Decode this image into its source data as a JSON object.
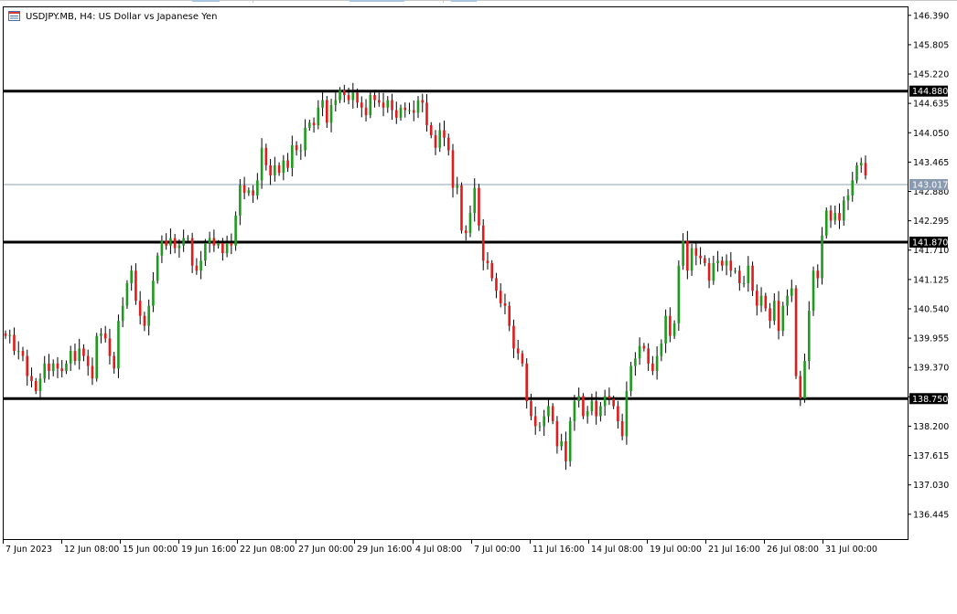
{
  "window": {
    "title": "USDJPY.MB, H4:  US Dollar vs Japanese Yen"
  },
  "colors": {
    "bull": "#1e9b1e",
    "bear": "#e01b1b",
    "wick": "#000000",
    "grid_frame": "#000000",
    "bid_line": "#8da2b4",
    "bid_label_bg": "#8a9ab0",
    "level_label_bg": "#000000"
  },
  "chart_data": {
    "type": "candlestick",
    "symbol": "USDJPY.MB",
    "timeframe": "H4",
    "description": "US Dollar vs Japanese Yen",
    "ylim": [
      135.95,
      146.55
    ],
    "y_ticks": [
      "146.390",
      "145.805",
      "145.220",
      "144.635",
      "144.050",
      "143.465",
      "142.880",
      "142.295",
      "141.710",
      "141.125",
      "140.540",
      "139.955",
      "139.370",
      "138.785",
      "138.200",
      "137.615",
      "137.030",
      "136.445"
    ],
    "x_ticks": [
      "7 Jun 2023",
      "12 Jun 08:00",
      "15 Jun 00:00",
      "19 Jun 16:00",
      "22 Jun 08:00",
      "27 Jun 00:00",
      "29 Jun 16:00",
      "4 Jul 08:00",
      "7 Jul 00:00",
      "11 Jul 16:00",
      "14 Jul 08:00",
      "19 Jul 00:00",
      "21 Jul 16:00",
      "26 Jul 08:00",
      "31 Jul 00:00"
    ],
    "horizontal_levels": [
      {
        "label": "144.880",
        "value": 144.88
      },
      {
        "label": "141.870",
        "value": 141.87
      },
      {
        "label": "138.750",
        "value": 138.75
      }
    ],
    "bid": {
      "label": "143.017",
      "value": 143.017
    },
    "closes": [
      140.0,
      140.02,
      139.7,
      139.7,
      139.6,
      139.2,
      139.1,
      138.9,
      139.15,
      139.45,
      139.3,
      139.45,
      139.35,
      139.3,
      139.45,
      139.7,
      139.5,
      139.75,
      139.6,
      139.4,
      139.15,
      140.0,
      140.05,
      139.95,
      139.6,
      139.35,
      140.3,
      140.6,
      141.05,
      141.3,
      140.7,
      140.4,
      140.2,
      140.6,
      141.1,
      141.6,
      141.9,
      141.8,
      141.95,
      141.75,
      141.8,
      141.95,
      141.95,
      141.4,
      141.3,
      141.5,
      141.85,
      141.95,
      141.8,
      141.85,
      141.65,
      141.85,
      141.8,
      142.4,
      143.0,
      142.85,
      142.9,
      142.8,
      143.1,
      143.75,
      143.4,
      143.2,
      143.4,
      143.25,
      143.5,
      143.35,
      143.8,
      143.7,
      143.7,
      144.15,
      144.25,
      144.2,
      144.55,
      144.7,
      144.25,
      144.6,
      144.7,
      144.9,
      144.8,
      144.7,
      144.85,
      144.65,
      144.55,
      144.4,
      144.8,
      144.7,
      144.65,
      144.55,
      144.7,
      144.5,
      144.35,
      144.55,
      144.5,
      144.5,
      144.45,
      144.7,
      144.65,
      144.2,
      144.0,
      143.75,
      144.1,
      143.95,
      143.7,
      142.95,
      143.0,
      142.1,
      142.05,
      142.45,
      142.95,
      142.2,
      141.5,
      141.45,
      141.15,
      140.9,
      140.65,
      140.6,
      140.2,
      139.75,
      139.65,
      139.45,
      138.7,
      138.4,
      138.2,
      138.2,
      138.4,
      138.6,
      138.3,
      137.8,
      137.9,
      137.5,
      138.3,
      138.7,
      138.8,
      138.4,
      138.5,
      138.7,
      138.4,
      138.6,
      138.8,
      138.75,
      138.6,
      138.3,
      138.0,
      138.9,
      139.4,
      139.55,
      139.8,
      139.75,
      139.45,
      139.3,
      139.6,
      139.85,
      140.4,
      140.0,
      140.25,
      141.4,
      141.9,
      141.3,
      141.75,
      141.6,
      141.55,
      141.45,
      141.1,
      141.45,
      141.5,
      141.4,
      141.5,
      141.3,
      141.3,
      141.05,
      141.05,
      141.4,
      140.9,
      140.6,
      140.8,
      140.55,
      140.3,
      140.7,
      140.1,
      140.6,
      140.8,
      140.95,
      139.2,
      138.75,
      139.5,
      140.5,
      141.3,
      141.15,
      142.0,
      142.5,
      142.3,
      142.45,
      142.3,
      142.7,
      142.8,
      143.1,
      143.4,
      143.45,
      143.2
    ]
  }
}
